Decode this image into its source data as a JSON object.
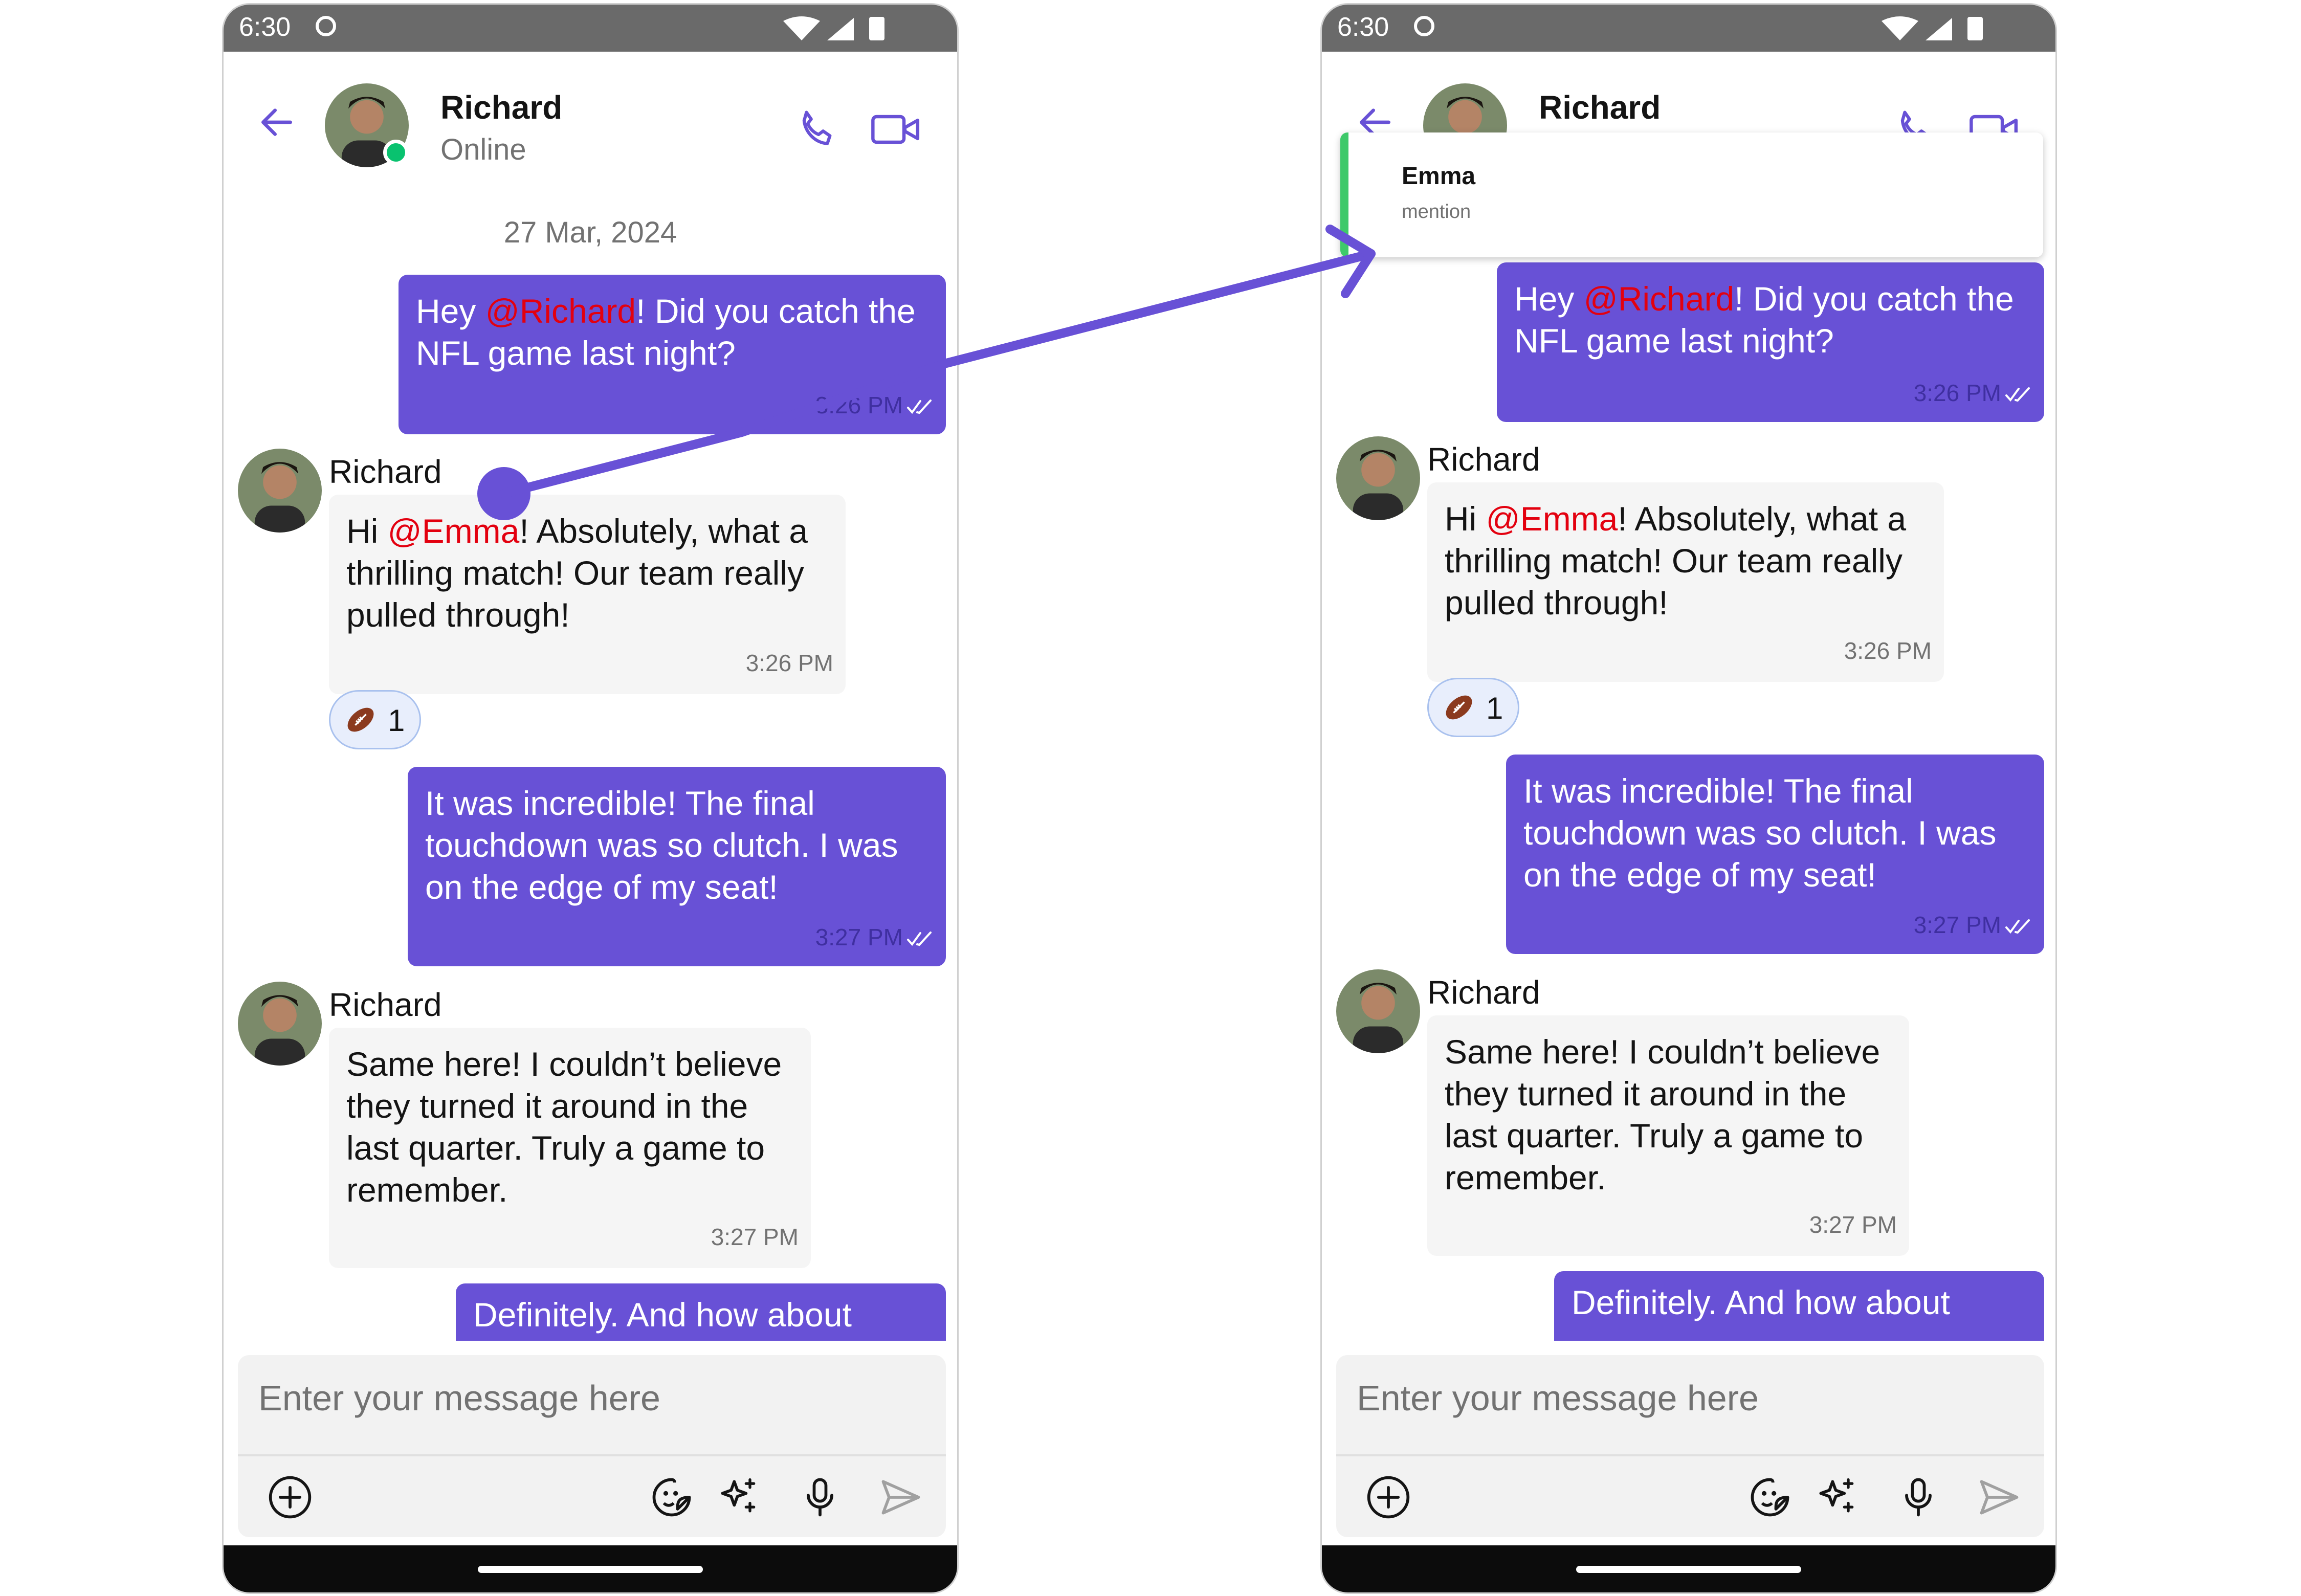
{
  "statusbar": {
    "time": "6:30"
  },
  "header": {
    "name": "Richard",
    "status": "Online"
  },
  "date_separator": "27 Mar, 2024",
  "messages": {
    "m1": {
      "before": "Hey ",
      "mention": "@Richard",
      "after": "! Did you catch the NFL game last night?",
      "time": "3:26 PM",
      "time_left_visible": "3:26 PM"
    },
    "m2": {
      "sender": "Richard",
      "before": "Hi ",
      "mention": "@Emma",
      "after": "! Absolutely, what a thrilling match! Our team really pulled through!",
      "time": "3:26 PM",
      "reaction_count": "1",
      "reaction_emoji": "american-football"
    },
    "m3": {
      "text": "It was incredible! The final touchdown was so clutch. I was on the edge of my seat!",
      "time": "3:27 PM"
    },
    "m4": {
      "sender": "Richard",
      "text": "Same here! I couldn’t believe they turned it around in the last quarter. Truly a game to remember.",
      "time": "3:27 PM"
    },
    "m5": {
      "text": "Definitely. And how about"
    }
  },
  "composer": {
    "placeholder": "Enter your message here"
  },
  "mention_suggestion": {
    "name": "Emma",
    "type": "mention"
  },
  "icons": [
    "back-arrow-icon",
    "phone-icon",
    "video-icon",
    "add-icon",
    "sticker-icon",
    "ai-sparkle-icon",
    "microphone-icon",
    "send-icon",
    "read-ticks-icon"
  ],
  "colors": {
    "accent": "#6851d6",
    "mention": "#e3000f",
    "online": "#09c26f",
    "incoming_bubble": "#f5f5f5",
    "mention_bar": "#3ec96a"
  }
}
